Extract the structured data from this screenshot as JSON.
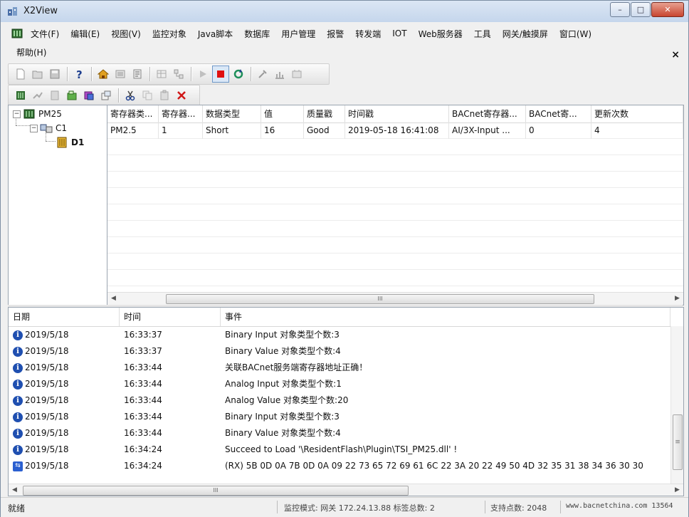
{
  "window": {
    "title": "X2View",
    "min_label": "–",
    "max_label": "□",
    "close_label": "✕"
  },
  "menu": {
    "row1": [
      "文件(F)",
      "编辑(E)",
      "视图(V)",
      "监控对象",
      "Java脚本",
      "数据库",
      "用户管理",
      "报警",
      "转发端",
      "IOT",
      "Web服务器",
      "工具",
      "网关/触摸屏",
      "窗口(W)"
    ],
    "row2": [
      "帮助(H)"
    ],
    "mdi_close": "×"
  },
  "tree": {
    "root": "PM25",
    "channel": "C1",
    "device": "D1",
    "root_expander": "−",
    "channel_expander": "−"
  },
  "grid": {
    "columns": [
      "寄存器类...",
      "寄存器...",
      "数据类型",
      "值",
      "质量戳",
      "时间戳",
      "BACnet寄存器...",
      "BACnet寄...",
      "更新次数"
    ],
    "rows": [
      [
        "PM2.5",
        "1",
        "Short",
        "16",
        "Good",
        "2019-05-18 16:41:08",
        "AI/3X-Input ...",
        "0",
        "4"
      ]
    ],
    "scroll_grip": "III"
  },
  "log": {
    "columns": [
      "日期",
      "时间",
      "事件"
    ],
    "rows": [
      {
        "icon": "info-icon",
        "date": "2019/5/18",
        "time": "16:33:37",
        "event": "Binary Input 对象类型个数:3"
      },
      {
        "icon": "info-icon",
        "date": "2019/5/18",
        "time": "16:33:37",
        "event": "Binary Value 对象类型个数:4"
      },
      {
        "icon": "info-icon",
        "date": "2019/5/18",
        "time": "16:33:44",
        "event": "关联BACnet服务端寄存器地址正确！"
      },
      {
        "icon": "info-icon",
        "date": "2019/5/18",
        "time": "16:33:44",
        "event": "Analog Input 对象类型个数:1"
      },
      {
        "icon": "info-icon",
        "date": "2019/5/18",
        "time": "16:33:44",
        "event": "Analog Value 对象类型个数:20"
      },
      {
        "icon": "info-icon",
        "date": "2019/5/18",
        "time": "16:33:44",
        "event": "Binary Input 对象类型个数:3"
      },
      {
        "icon": "info-icon",
        "date": "2019/5/18",
        "time": "16:33:44",
        "event": "Binary Value 对象类型个数:4"
      },
      {
        "icon": "info-icon",
        "date": "2019/5/18",
        "time": "16:34:24",
        "event": "Succeed to Load  '\\ResidentFlash\\Plugin\\TSI_PM25.dll' !"
      },
      {
        "icon": "rx-icon",
        "date": "2019/5/18",
        "time": "16:34:24",
        "event": "(RX) 5B 0D 0A 7B 0D 0A 09 22 73 65 72 69 61 6C 22 3A 20 22 49 50 4D 32 35 31 38 34 36 30 30"
      }
    ],
    "scroll_grip": "III",
    "vscroll_grip": "≡"
  },
  "status": {
    "ready": "就绪",
    "mode": "监控模式: 网关 172.24.13.88 标签总数: 2",
    "points": "支持点数: 2048",
    "site": "www.bacnetchina.com 13564"
  },
  "colors": {
    "stop_red": "#e01010",
    "info_blue": "#1f4fb0",
    "delete_red": "#d01818"
  }
}
